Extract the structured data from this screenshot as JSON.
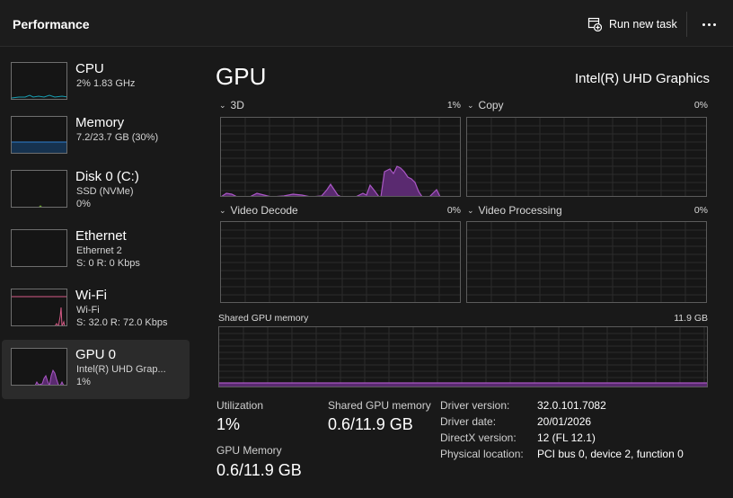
{
  "header": {
    "title": "Performance",
    "run_new_task_label": "Run new task",
    "more_icon": "more-horizontal-icon",
    "run_task_icon": "run-task-icon"
  },
  "sidebar": {
    "items": [
      {
        "name": "CPU",
        "line1": "2%  1.83 GHz",
        "line2": "",
        "color": "#17a0b4"
      },
      {
        "name": "Memory",
        "line1": "7.2/23.7 GB (30%)",
        "line2": "",
        "color": "#2f7fd0"
      },
      {
        "name": "Disk 0 (C:)",
        "line1": "SSD (NVMe)",
        "line2": "0%",
        "color": "#6ba82c"
      },
      {
        "name": "Ethernet",
        "line1": "Ethernet 2",
        "line2": "S: 0 R: 0 Kbps",
        "color": "#a9517a"
      },
      {
        "name": "Wi-Fi",
        "line1": "Wi-Fi",
        "line2": "S: 32.0 R: 72.0 Kbps",
        "color": "#d65a86"
      },
      {
        "name": "GPU 0",
        "line1": "Intel(R) UHD Grap...",
        "line2": "1%",
        "color": "#a957c4",
        "selected": true
      }
    ]
  },
  "main": {
    "title": "GPU",
    "device_name": "Intel(R) UHD Graphics",
    "accent_color": "#a957c4",
    "engines": [
      {
        "label": "3D",
        "percent": "1%"
      },
      {
        "label": "Copy",
        "percent": "0%"
      },
      {
        "label": "Video Decode",
        "percent": "0%"
      },
      {
        "label": "Video Processing",
        "percent": "0%"
      }
    ],
    "shared_memory_label": "Shared GPU memory",
    "shared_memory_max": "11.9 GB"
  },
  "stats": {
    "utilization_label": "Utilization",
    "utilization_value": "1%",
    "shared_label": "Shared GPU memory",
    "shared_value": "0.6/11.9 GB",
    "gpu_memory_label": "GPU Memory",
    "gpu_memory_value": "0.6/11.9 GB"
  },
  "info": [
    {
      "key": "Driver version:",
      "value": "32.0.101.7082"
    },
    {
      "key": "Driver date:",
      "value": "20/01/2026"
    },
    {
      "key": "DirectX version:",
      "value": "12 (FL 12.1)"
    },
    {
      "key": "Physical location:",
      "value": "PCI bus 0, device 2, function 0"
    }
  ]
}
